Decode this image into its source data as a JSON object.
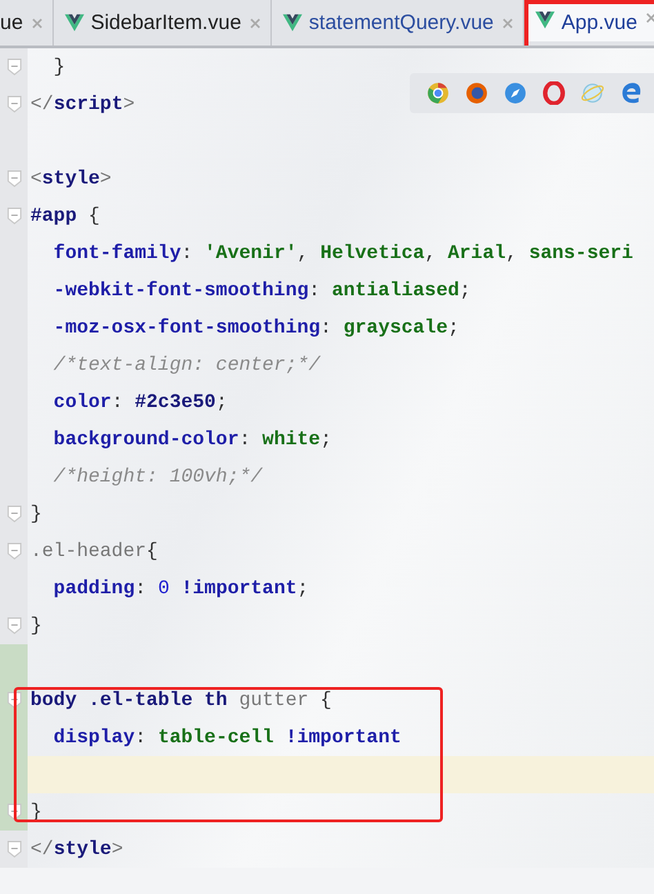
{
  "tabs": [
    {
      "label": "ue",
      "selected": false,
      "vue": false,
      "boxed": false
    },
    {
      "label": "SidebarItem.vue",
      "selected": false,
      "vue": true,
      "boxed": false
    },
    {
      "label": "statementQuery.vue",
      "selected": false,
      "vue": true,
      "boxed": false
    },
    {
      "label": "App.vue",
      "selected": true,
      "vue": true,
      "boxed": true
    }
  ],
  "code": [
    {
      "boxed": false,
      "lines": [
        {
          "fold": true,
          "changed": false,
          "current": false,
          "tokens": [
            {
              "kind": "punct",
              "t": "  }"
            }
          ]
        },
        {
          "fold": true,
          "changed": false,
          "current": false,
          "tokens": [
            {
              "kind": "bracket",
              "t": "</"
            },
            {
              "kind": "tag",
              "t": "script"
            },
            {
              "kind": "bracket",
              "t": ">"
            }
          ]
        },
        {
          "fold": false,
          "changed": false,
          "current": false
        },
        {
          "fold": true,
          "changed": false,
          "current": false,
          "tokens": [
            {
              "kind": "bracket",
              "t": "<"
            },
            {
              "kind": "tag",
              "t": "style"
            },
            {
              "kind": "bracket",
              "t": ">"
            }
          ]
        },
        {
          "fold": true,
          "changed": false,
          "current": false,
          "tokens": [
            {
              "kind": "selector",
              "t": "#app"
            },
            {
              "kind": "punct",
              "t": " {"
            }
          ]
        },
        {
          "fold": false,
          "changed": false,
          "current": false,
          "tokens": [
            {
              "kind": "prop",
              "t": "  font-family"
            },
            {
              "kind": "punct",
              "t": ": "
            },
            {
              "kind": "str",
              "t": "'Avenir'"
            },
            {
              "kind": "punct",
              "t": ", "
            },
            {
              "kind": "val",
              "t": "Helvetica"
            },
            {
              "kind": "punct",
              "t": ", "
            },
            {
              "kind": "val",
              "t": "Arial"
            },
            {
              "kind": "punct",
              "t": ", "
            },
            {
              "kind": "val",
              "t": "sans-seri"
            }
          ]
        },
        {
          "fold": false,
          "changed": false,
          "current": false,
          "tokens": [
            {
              "kind": "prop",
              "t": "  -webkit-font-smoothing"
            },
            {
              "kind": "punct",
              "t": ": "
            },
            {
              "kind": "val",
              "t": "antialiased"
            },
            {
              "kind": "punct",
              "t": ";"
            }
          ]
        },
        {
          "fold": false,
          "changed": false,
          "current": false,
          "tokens": [
            {
              "kind": "prop",
              "t": "  -moz-osx-font-smoothing"
            },
            {
              "kind": "punct",
              "t": ": "
            },
            {
              "kind": "val",
              "t": "grayscale"
            },
            {
              "kind": "punct",
              "t": ";"
            }
          ]
        },
        {
          "fold": false,
          "changed": false,
          "current": false,
          "tokens": [
            {
              "kind": "comment",
              "t": "  /*text-align: center;*/"
            }
          ]
        },
        {
          "fold": false,
          "changed": false,
          "current": false,
          "tokens": [
            {
              "kind": "prop",
              "t": "  color"
            },
            {
              "kind": "punct",
              "t": ": "
            },
            {
              "kind": "num",
              "t": "#2c3e50"
            },
            {
              "kind": "punct",
              "t": ";"
            }
          ]
        },
        {
          "fold": false,
          "changed": false,
          "current": false,
          "tokens": [
            {
              "kind": "prop",
              "t": "  background-color"
            },
            {
              "kind": "punct",
              "t": ": "
            },
            {
              "kind": "val",
              "t": "white"
            },
            {
              "kind": "punct",
              "t": ";"
            }
          ]
        },
        {
          "fold": false,
          "changed": false,
          "current": false,
          "tokens": [
            {
              "kind": "comment",
              "t": "  /*height: 100vh;*/"
            }
          ]
        },
        {
          "fold": true,
          "changed": false,
          "current": false,
          "tokens": [
            {
              "kind": "punct",
              "t": "}"
            }
          ]
        },
        {
          "fold": true,
          "changed": false,
          "current": false,
          "tokens": [
            {
              "kind": "muted",
              "t": ".el-header"
            },
            {
              "kind": "punct",
              "t": "{"
            }
          ]
        },
        {
          "fold": false,
          "changed": false,
          "current": false,
          "tokens": [
            {
              "kind": "prop",
              "t": "  padding"
            },
            {
              "kind": "punct",
              "t": ": "
            },
            {
              "kind": "numb",
              "t": "0"
            },
            {
              "kind": "prop",
              "t": " !important"
            },
            {
              "kind": "punct",
              "t": ";"
            }
          ]
        },
        {
          "fold": true,
          "changed": false,
          "current": false,
          "tokens": [
            {
              "kind": "punct",
              "t": "}"
            }
          ]
        },
        {
          "fold": false,
          "changed": true,
          "current": false
        }
      ]
    },
    {
      "boxed": true,
      "lines": [
        {
          "fold": true,
          "changed": true,
          "current": false,
          "tokens": [
            {
              "kind": "selector",
              "t": "body .el-table th"
            },
            {
              "kind": "muted",
              "t": " gutter"
            },
            {
              "kind": "punct",
              "t": " {"
            }
          ]
        },
        {
          "fold": false,
          "changed": true,
          "current": false,
          "tokens": [
            {
              "kind": "prop",
              "t": "  display"
            },
            {
              "kind": "punct",
              "t": ": "
            },
            {
              "kind": "val",
              "t": "table-cell"
            },
            {
              "kind": "prop",
              "t": " !important"
            }
          ]
        },
        {
          "fold": false,
          "changed": true,
          "current": true
        },
        {
          "fold": true,
          "changed": true,
          "current": false,
          "tokens": [
            {
              "kind": "punct",
              "t": "}"
            }
          ]
        }
      ]
    },
    {
      "boxed": false,
      "lines": [
        {
          "fold": true,
          "changed": false,
          "current": false,
          "tokens": [
            {
              "kind": "bracket",
              "t": "</"
            },
            {
              "kind": "tag",
              "t": "style"
            },
            {
              "kind": "bracket",
              "t": ">"
            }
          ]
        }
      ]
    }
  ]
}
